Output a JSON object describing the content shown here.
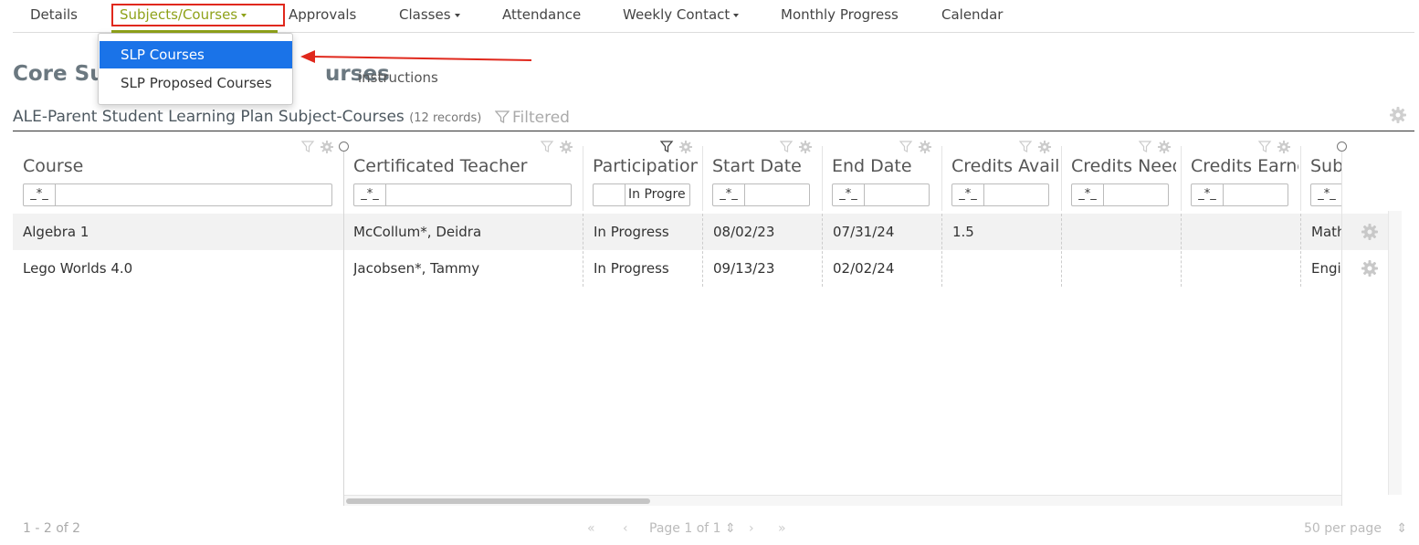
{
  "nav": {
    "details": "Details",
    "subjects_courses": "Subjects/Courses",
    "approvals": "Approvals",
    "classes": "Classes",
    "attendance": "Attendance",
    "weekly_contact": "Weekly Contact",
    "monthly_progress": "Monthly Progress",
    "calendar": "Calendar"
  },
  "dropdown": {
    "items": [
      "SLP Courses",
      "SLP Proposed Courses"
    ],
    "selected": "SLP Courses"
  },
  "page": {
    "title_left": "Core Sub",
    "title_right": "urses",
    "instructions": "instructions"
  },
  "section": {
    "title": "ALE-Parent Student Learning Plan Subject-Courses",
    "record_count": "(12 records)",
    "filtered_label": "Filtered"
  },
  "grid": {
    "columns": [
      {
        "label": "Course",
        "filter_op": "_*_",
        "filter_value": ""
      },
      {
        "label": "Certificated Teacher",
        "filter_op": "_*_",
        "filter_value": ""
      },
      {
        "label": "Participation",
        "filter_op": "",
        "filter_value": "In Progre"
      },
      {
        "label": "Start Date",
        "filter_op": "_*_",
        "filter_value": ""
      },
      {
        "label": "End Date",
        "filter_op": "_*_",
        "filter_value": ""
      },
      {
        "label": "Credits Availa",
        "filter_op": "_*_",
        "filter_value": ""
      },
      {
        "label": "Credits Need",
        "filter_op": "_*_",
        "filter_value": ""
      },
      {
        "label": "Credits Earne",
        "filter_op": "_*_",
        "filter_value": ""
      },
      {
        "label": "Sub",
        "filter_op": "_*_",
        "filter_value": ""
      }
    ],
    "rows": [
      [
        "Algebra 1",
        "McCollum*, Deidra",
        "In Progress",
        "08/02/23",
        "07/31/24",
        "1.5",
        "",
        "",
        "Math"
      ],
      [
        "Lego Worlds 4.0",
        "Jacobsen*, Tammy",
        "In Progress",
        "09/13/23",
        "02/02/24",
        "",
        "",
        "",
        "Engin"
      ]
    ]
  },
  "pager": {
    "range": "1 - 2 of 2",
    "page": "Page 1 of 1",
    "per_page": "50 per page"
  },
  "colors": {
    "accent": "#8fa21a",
    "highlight_border": "#e0281c",
    "selected_bg": "#1a73e8"
  },
  "icons": {
    "filter": "filter-icon",
    "gear": "gear-icon",
    "arrow": "red-arrow-annotation"
  }
}
